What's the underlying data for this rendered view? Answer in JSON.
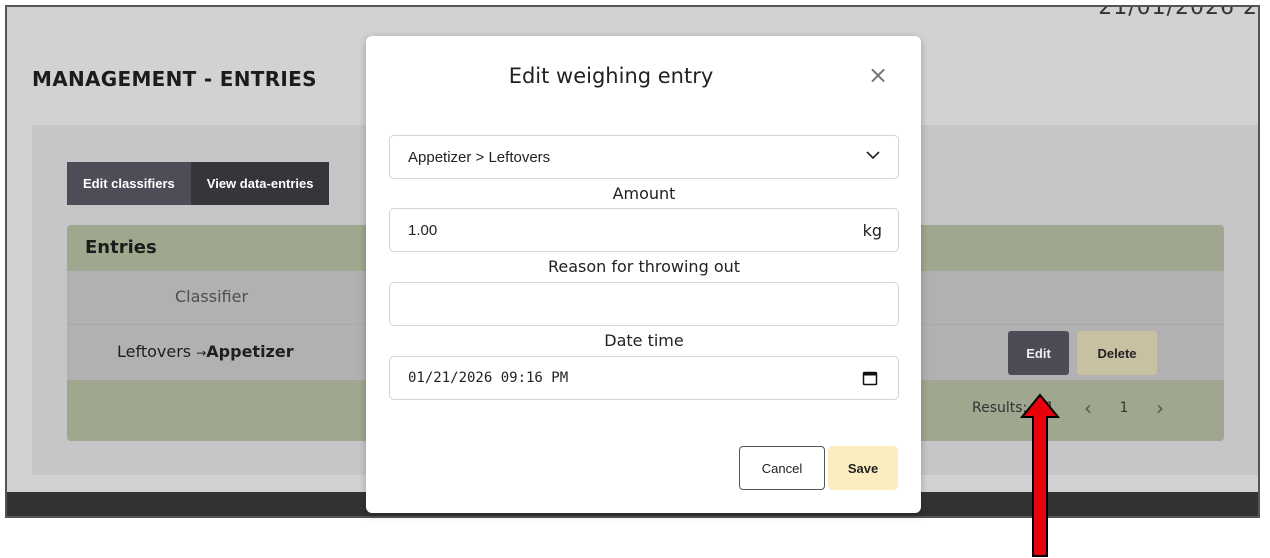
{
  "header": {
    "date_fragment": "21/01/2026 2",
    "page_title": "MANAGEMENT - ENTRIES"
  },
  "tabs": [
    {
      "label": "Edit classifiers"
    },
    {
      "label": "View data-entries"
    }
  ],
  "entries": {
    "title": "Entries",
    "column_header": "Classifier",
    "rows": [
      {
        "classifier_child": "Leftovers",
        "arrow": "→",
        "classifier_parent": "Appetizer"
      }
    ],
    "actions": {
      "edit": "Edit",
      "delete": "Delete"
    },
    "footer": {
      "results": "Results: 1/1",
      "prev": "‹",
      "page": "1",
      "next": "›"
    }
  },
  "modal": {
    "title": "Edit weighing entry",
    "close_icon": "close-icon",
    "classifier_select": "Appetizer > Leftovers",
    "amount_label": "Amount",
    "amount_value": "1.00",
    "amount_unit": "kg",
    "reason_label": "Reason for throwing out",
    "reason_value": "",
    "datetime_label": "Date time",
    "datetime_value": "01/21/2026 09:16 PM",
    "cancel_label": "Cancel",
    "save_label": "Save"
  },
  "colors": {
    "annotation_arrow": "#e8000b",
    "header_band": "#9fa88e",
    "save_button": "#fcedc1"
  }
}
